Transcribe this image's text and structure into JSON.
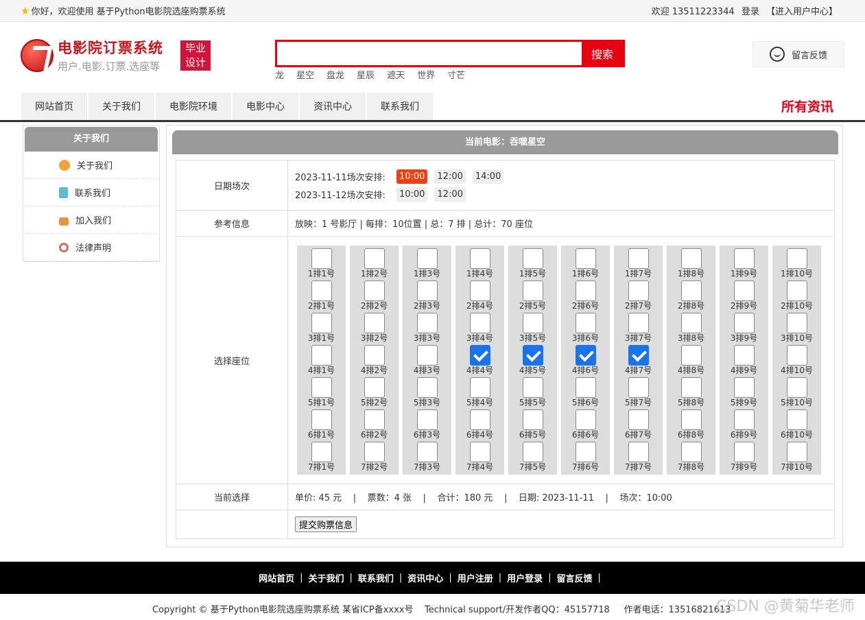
{
  "topbar": {
    "greeting": "你好，欢迎使用 基于Python电影院选座购票系统",
    "welcome": "欢迎 13511223344",
    "login": "登录",
    "user_center": "【进入用户中心】"
  },
  "header": {
    "logo_title": "电影院订票系统",
    "logo_sub": "用户.电影.订票.选座等",
    "badge_line1": "毕业",
    "badge_line2": "设计",
    "search_value": "",
    "search_button": "搜索",
    "hot_words": [
      "龙",
      "星空",
      "盘龙",
      "星辰",
      "遮天",
      "世界",
      "寸芒"
    ],
    "feedback": "留言反馈"
  },
  "nav": {
    "items": [
      "网站首页",
      "关于我们",
      "电影院环境",
      "电影中心",
      "资讯中心",
      "联系我们"
    ],
    "all_news": "所有资讯"
  },
  "sidebar": {
    "title": "关于我们",
    "items": [
      {
        "label": "关于我们",
        "icon": "about-icon"
      },
      {
        "label": "联系我们",
        "icon": "clipboard-icon"
      },
      {
        "label": "加入我们",
        "icon": "lock-icon"
      },
      {
        "label": "法律声明",
        "icon": "power-icon"
      }
    ]
  },
  "main": {
    "title": "当前电影：吞噬星空",
    "date_label": "日期场次",
    "schedules": [
      {
        "date": "2023-11-11场次安排:",
        "times": [
          "10:00",
          "12:00",
          "14:00"
        ],
        "active": 0
      },
      {
        "date": "2023-11-12场次安排:",
        "times": [
          "10:00",
          "12:00"
        ],
        "active": -1
      }
    ],
    "info_label": "参考信息",
    "info": "放映：1 号影厅 | 每排：10位置 | 总：7 排 | 总计：70 座位",
    "seat_label": "选择座位",
    "rows": 7,
    "cols": 10,
    "seat_format": "{r}排{c}号",
    "selected": [
      [
        4,
        4
      ],
      [
        4,
        5
      ],
      [
        4,
        6
      ],
      [
        4,
        7
      ]
    ],
    "current_label": "当前选择",
    "current": "单价: 45 元    |    票数：4 张    |    合计：180 元    |    日期: 2023-11-11    |    场次：10:00",
    "submit_label": "提交购票信息"
  },
  "footer": {
    "links": [
      "网站首页",
      "关于我们",
      "联系我们",
      "资讯中心",
      "用户注册",
      "用户登录",
      "留言反馈"
    ],
    "copyright": "Copyright © 基于Python电影院选座购票系统 某省ICP备xxxx号    Technical support/开发作者QQ：45157718     作者电话：13516821613",
    "watermark": "CSDN @黄菊华老师"
  }
}
